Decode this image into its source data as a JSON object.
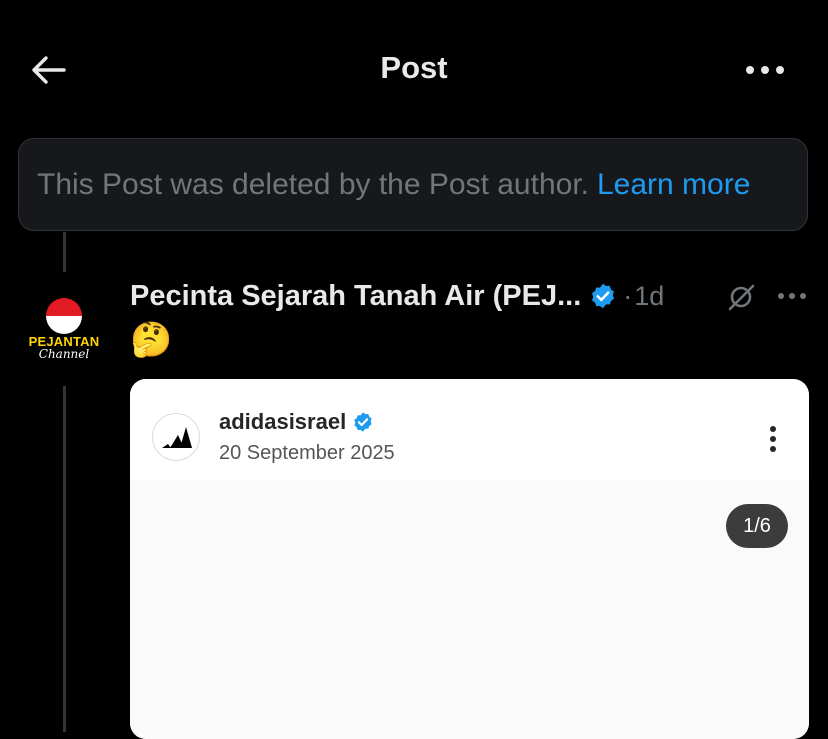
{
  "header": {
    "title": "Post",
    "back_icon": "arrow-left-icon",
    "more_icon": "more-horizontal-icon"
  },
  "notice": {
    "text": "This Post was deleted by the Post author.",
    "link": "Learn more"
  },
  "post": {
    "author": "Pecinta Sejarah Tanah Air (PEJ...",
    "verified": true,
    "separator": "·",
    "time": "1d",
    "emoji": "🤔",
    "avatar": {
      "brand": "PEJANTAN",
      "sub": "Channel"
    }
  },
  "embed": {
    "username": "adidasisrael",
    "verified": true,
    "date": "20 September 2025",
    "counter": "1/6"
  },
  "colors": {
    "background": "#000000",
    "accent": "#1d9bf0",
    "muted": "#71767b"
  }
}
